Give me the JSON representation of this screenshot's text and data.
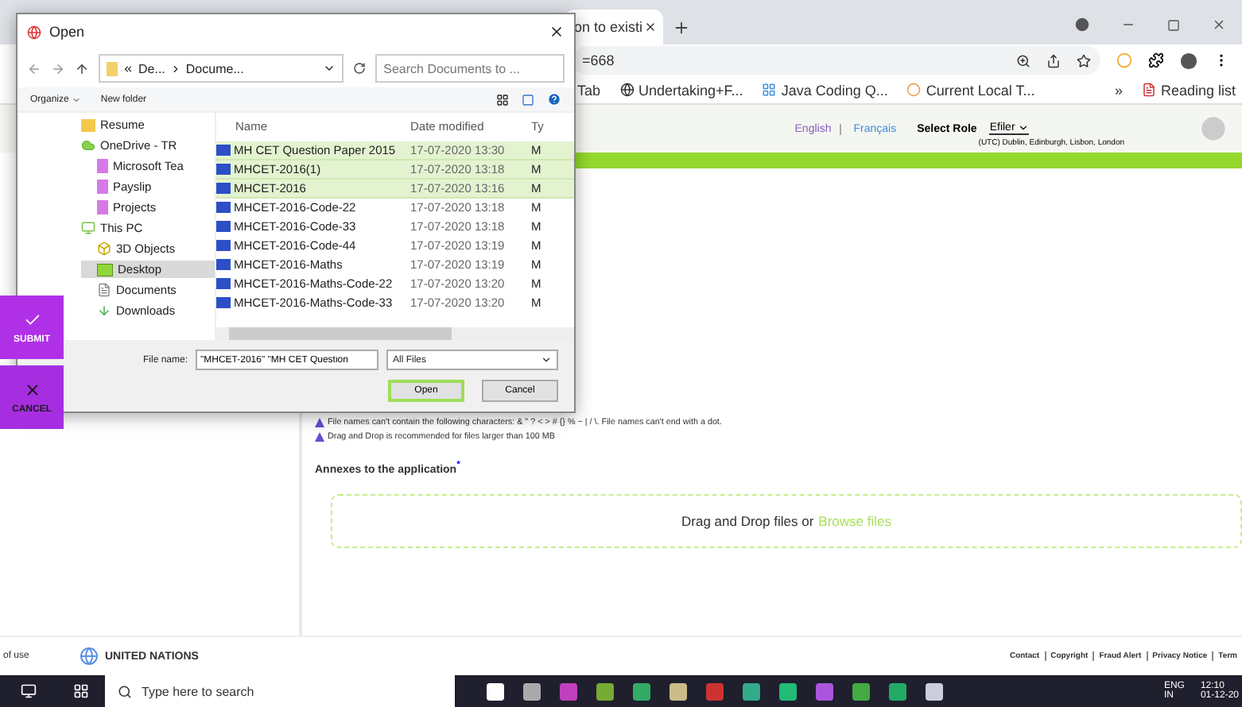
{
  "browser": {
    "tab_title": "on to existi",
    "address": "=668",
    "bookmarks": [
      "Tab",
      "Undertaking+F...",
      "Java Coding Q...",
      "Current Local T..."
    ],
    "more": "»",
    "reading_list": "Reading list"
  },
  "page_header": {
    "languages": [
      "English",
      "Français"
    ],
    "role_label": "Select Role",
    "role_value": "Efiler",
    "timezone": "(UTC) Dublin, Edinburgh, Lisbon, London"
  },
  "side_actions": [
    {
      "kind": "submit",
      "label": "SUBMIT"
    },
    {
      "kind": "cancel",
      "label": "CANCEL"
    }
  ],
  "notes": [
    "File names can't contain the following characters: & \" ? < > # {} % ~ | / \\. File names can't end with a dot.",
    "Drag and Drop is recommended for files larger than 100 MB"
  ],
  "annexes": {
    "label": "Annexes to the application",
    "required_mark": "*",
    "drop_text": "Drag and Drop files or",
    "browse_link": "Browse files"
  },
  "footer": {
    "left": "of use",
    "org": "UNITED NATIONS",
    "links": [
      "Contact",
      "Copyright",
      "Fraud Alert",
      "Privacy Notice",
      "Term"
    ]
  },
  "dialog": {
    "title": "Open",
    "path": [
      "De...",
      "Docume..."
    ],
    "search_placeholder": "Search Documents to ...",
    "organize": "Organize",
    "new_folder": "New folder",
    "nav": [
      {
        "label": "Resume",
        "selected": false
      },
      {
        "label": "OneDrive - TR",
        "selected": false,
        "children": [
          {
            "label": "Microsoft Tea",
            "selected": false
          },
          {
            "label": "Payslip",
            "selected": false
          },
          {
            "label": "Projects",
            "selected": false
          }
        ]
      },
      {
        "label": "This PC",
        "selected": false,
        "children": [
          {
            "label": "3D Objects",
            "selected": false
          },
          {
            "label": "Desktop",
            "selected": true
          },
          {
            "label": "Documents",
            "selected": false
          },
          {
            "label": "Downloads",
            "selected": false
          }
        ]
      }
    ],
    "columns": [
      "Name",
      "Date modified",
      "Ty"
    ],
    "files": [
      {
        "name": "MH CET Question Paper 2015",
        "date": "17-07-2020 13:30",
        "type": "M",
        "selected": true
      },
      {
        "name": "MHCET-2016(1)",
        "date": "17-07-2020 13:18",
        "type": "M",
        "selected": true
      },
      {
        "name": "MHCET-2016",
        "date": "17-07-2020 13:16",
        "type": "M",
        "selected": true
      },
      {
        "name": "MHCET-2016-Code-22",
        "date": "17-07-2020 13:18",
        "type": "M",
        "selected": false
      },
      {
        "name": "MHCET-2016-Code-33",
        "date": "17-07-2020 13:18",
        "type": "M",
        "selected": false
      },
      {
        "name": "MHCET-2016-Code-44",
        "date": "17-07-2020 13:19",
        "type": "M",
        "selected": false
      },
      {
        "name": "MHCET-2016-Maths",
        "date": "17-07-2020 13:19",
        "type": "M",
        "selected": false
      },
      {
        "name": "MHCET-2016-Maths-Code-22",
        "date": "17-07-2020 13:20",
        "type": "M",
        "selected": false
      },
      {
        "name": "MHCET-2016-Maths-Code-33",
        "date": "17-07-2020 13:20",
        "type": "M",
        "selected": false
      }
    ],
    "file_name_label": "File name:",
    "file_name_value": "\"MHCET-2016\" \"MH CET Question",
    "filter": "All Files",
    "buttons": [
      {
        "kind": "primary",
        "label": "Open"
      },
      {
        "kind": "secondary",
        "label": "Cancel"
      }
    ]
  },
  "taskbar": {
    "search_placeholder": "Type here to search",
    "lang": "ENG",
    "region": "IN",
    "time": "12:10",
    "date": "01-12-20"
  }
}
